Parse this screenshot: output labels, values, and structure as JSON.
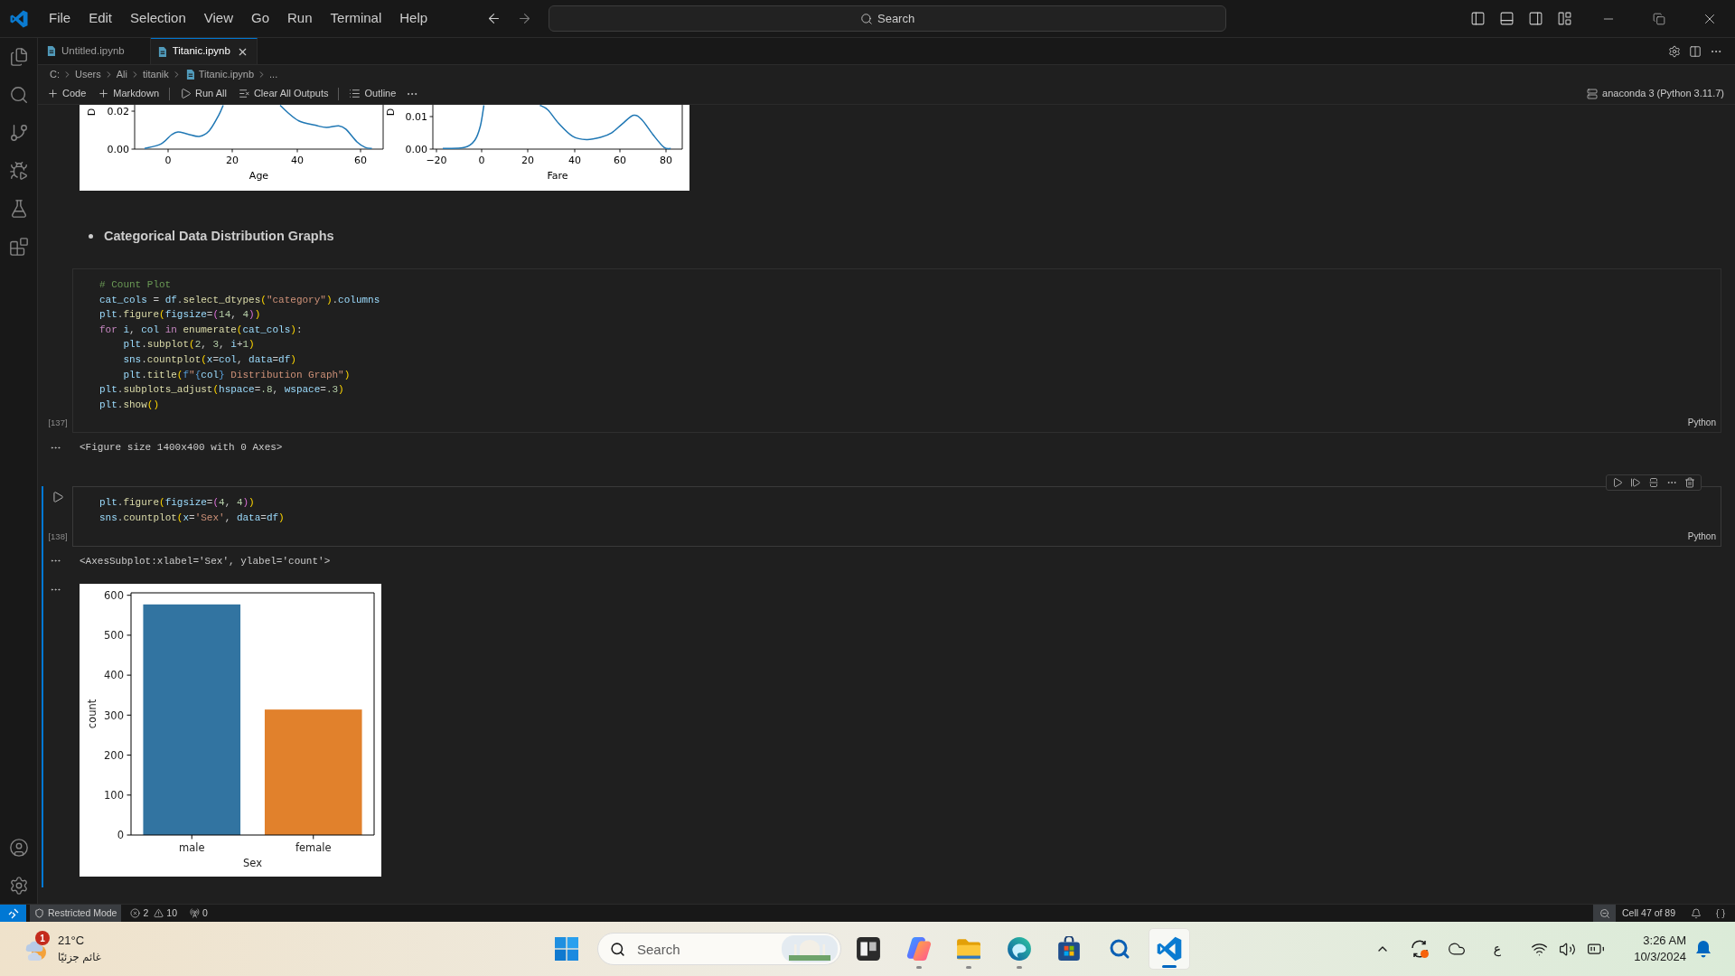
{
  "window": {
    "menu": [
      "File",
      "Edit",
      "Selection",
      "View",
      "Go",
      "Run",
      "Terminal",
      "Help"
    ],
    "search": {
      "label": "Search"
    }
  },
  "tabs": [
    {
      "label": "Untitled.ipynb",
      "selected": false
    },
    {
      "label": "Titanic.ipynb",
      "selected": true
    }
  ],
  "breadcrumb": {
    "folders": [
      "C:",
      "Users",
      "Ali",
      "titanik"
    ],
    "file": "Titanic.ipynb",
    "tail": "..."
  },
  "toolbar": {
    "items": [
      {
        "kind": "add",
        "label": "Code"
      },
      {
        "kind": "add",
        "label": "Markdown"
      },
      {
        "kind": "separator"
      },
      {
        "kind": "run",
        "label": "Run All"
      },
      {
        "kind": "clear",
        "label": "Clear All Outputs"
      },
      {
        "kind": "separator"
      },
      {
        "kind": "outline",
        "label": "Outline"
      },
      {
        "kind": "more"
      }
    ],
    "kernel": "anaconda 3 (Python 3.11.7)"
  },
  "notebook": [
    {
      "kind": "figure",
      "selected": false,
      "panels": [
        {
          "ylabel": "D",
          "yticks": [
            "0.02",
            "0.00"
          ],
          "xticks": [
            "0",
            "20",
            "40",
            "60"
          ],
          "xlabel": "Age"
        },
        {
          "ylabel": "D",
          "yticks": [
            "0.01",
            "0.00"
          ],
          "xticks": [
            "−20",
            "0",
            "20",
            "40",
            "60",
            "80"
          ],
          "xlabel": "Fare"
        }
      ]
    },
    {
      "kind": "markdown",
      "selected": false,
      "bullets": [
        "Categorical Data Distribution Graphs"
      ]
    },
    {
      "kind": "code",
      "selected": false,
      "execution_count": "[137]",
      "language": "Python",
      "lines": [
        [
          {
            "kind": "comment",
            "text": "# Count Plot"
          }
        ],
        [
          {
            "kind": "variable",
            "text": "cat_cols"
          },
          {
            "kind": "operator",
            "text": " = "
          },
          {
            "kind": "variable",
            "text": "df"
          },
          {
            "kind": "operator",
            "text": "."
          },
          {
            "kind": "function",
            "text": "select_dtypes"
          },
          {
            "kind": "bracket1",
            "text": "("
          },
          {
            "kind": "string",
            "text": "\"category\""
          },
          {
            "kind": "bracket1",
            "text": ")"
          },
          {
            "kind": "operator",
            "text": "."
          },
          {
            "kind": "variable",
            "text": "columns"
          }
        ],
        [
          {
            "kind": "variable",
            "text": "plt"
          },
          {
            "kind": "operator",
            "text": "."
          },
          {
            "kind": "function",
            "text": "figure"
          },
          {
            "kind": "bracket1",
            "text": "("
          },
          {
            "kind": "variable",
            "text": "figsize"
          },
          {
            "kind": "operator",
            "text": "="
          },
          {
            "kind": "bracket2",
            "text": "("
          },
          {
            "kind": "number",
            "text": "14"
          },
          {
            "kind": "operator",
            "text": ", "
          },
          {
            "kind": "number",
            "text": "4"
          },
          {
            "kind": "bracket2",
            "text": ")"
          },
          {
            "kind": "bracket1",
            "text": ")"
          }
        ],
        [
          {
            "kind": "keyword",
            "text": "for "
          },
          {
            "kind": "variable",
            "text": "i"
          },
          {
            "kind": "operator",
            "text": ", "
          },
          {
            "kind": "variable",
            "text": "col "
          },
          {
            "kind": "keyword",
            "text": "in "
          },
          {
            "kind": "function",
            "text": "enumerate"
          },
          {
            "kind": "bracket1",
            "text": "("
          },
          {
            "kind": "variable",
            "text": "cat_cols"
          },
          {
            "kind": "bracket1",
            "text": ")"
          },
          {
            "kind": "operator",
            "text": ":"
          }
        ],
        [
          {
            "kind": "variable",
            "text": "    plt"
          },
          {
            "kind": "operator",
            "text": "."
          },
          {
            "kind": "function",
            "text": "subplot"
          },
          {
            "kind": "bracket1",
            "text": "("
          },
          {
            "kind": "number",
            "text": "2"
          },
          {
            "kind": "operator",
            "text": ", "
          },
          {
            "kind": "number",
            "text": "3"
          },
          {
            "kind": "operator",
            "text": ", "
          },
          {
            "kind": "variable",
            "text": "i"
          },
          {
            "kind": "operator",
            "text": "+"
          },
          {
            "kind": "number",
            "text": "1"
          },
          {
            "kind": "bracket1",
            "text": ")"
          }
        ],
        [
          {
            "kind": "variable",
            "text": "    sns"
          },
          {
            "kind": "operator",
            "text": "."
          },
          {
            "kind": "function",
            "text": "countplot"
          },
          {
            "kind": "bracket1",
            "text": "("
          },
          {
            "kind": "variable",
            "text": "x"
          },
          {
            "kind": "operator",
            "text": "="
          },
          {
            "kind": "variable",
            "text": "col"
          },
          {
            "kind": "operator",
            "text": ", "
          },
          {
            "kind": "variable",
            "text": "data"
          },
          {
            "kind": "operator",
            "text": "="
          },
          {
            "kind": "variable",
            "text": "df"
          },
          {
            "kind": "bracket1",
            "text": ")"
          }
        ],
        [
          {
            "kind": "variable",
            "text": "    plt"
          },
          {
            "kind": "operator",
            "text": "."
          },
          {
            "kind": "function",
            "text": "title"
          },
          {
            "kind": "bracket1",
            "text": "("
          },
          {
            "kind": "storage",
            "text": "f"
          },
          {
            "kind": "string",
            "text": "\""
          },
          {
            "kind": "storage",
            "text": "{"
          },
          {
            "kind": "variable",
            "text": "col"
          },
          {
            "kind": "storage",
            "text": "}"
          },
          {
            "kind": "string",
            "text": " Distribution Graph\""
          },
          {
            "kind": "bracket1",
            "text": ")"
          }
        ],
        [
          {
            "kind": "variable",
            "text": "plt"
          },
          {
            "kind": "operator",
            "text": "."
          },
          {
            "kind": "function",
            "text": "subplots_adjust"
          },
          {
            "kind": "bracket1",
            "text": "("
          },
          {
            "kind": "variable",
            "text": "hspace"
          },
          {
            "kind": "operator",
            "text": "="
          },
          {
            "kind": "number",
            "text": ".8"
          },
          {
            "kind": "operator",
            "text": ", "
          },
          {
            "kind": "variable",
            "text": "wspace"
          },
          {
            "kind": "operator",
            "text": "="
          },
          {
            "kind": "number",
            "text": ".3"
          },
          {
            "kind": "bracket1",
            "text": ")"
          }
        ],
        [
          {
            "kind": "variable",
            "text": "plt"
          },
          {
            "kind": "operator",
            "text": "."
          },
          {
            "kind": "function",
            "text": "show"
          },
          {
            "kind": "bracket1",
            "text": "()"
          }
        ]
      ],
      "outputs": [
        {
          "kind": "text",
          "text": "<Figure size 1400x400 with 0 Axes>"
        }
      ]
    },
    {
      "kind": "code",
      "selected": true,
      "execution_count": "[138]",
      "language": "Python",
      "lines": [
        [
          {
            "kind": "variable",
            "text": "plt"
          },
          {
            "kind": "operator",
            "text": "."
          },
          {
            "kind": "function",
            "text": "figure"
          },
          {
            "kind": "bracket1",
            "text": "("
          },
          {
            "kind": "variable",
            "text": "figsize"
          },
          {
            "kind": "operator",
            "text": "="
          },
          {
            "kind": "bracket2",
            "text": "("
          },
          {
            "kind": "number",
            "text": "4"
          },
          {
            "kind": "operator",
            "text": ", "
          },
          {
            "kind": "number",
            "text": "4"
          },
          {
            "kind": "bracket2",
            "text": ")"
          },
          {
            "kind": "bracket1",
            "text": ")"
          }
        ],
        [
          {
            "kind": "variable",
            "text": "sns"
          },
          {
            "kind": "operator",
            "text": "."
          },
          {
            "kind": "function",
            "text": "countplot"
          },
          {
            "kind": "bracket1",
            "text": "("
          },
          {
            "kind": "variable",
            "text": "x"
          },
          {
            "kind": "operator",
            "text": "="
          },
          {
            "kind": "string",
            "text": "'Sex'"
          },
          {
            "kind": "operator",
            "text": ", "
          },
          {
            "kind": "variable",
            "text": "data"
          },
          {
            "kind": "operator",
            "text": "="
          },
          {
            "kind": "variable",
            "text": "df"
          },
          {
            "kind": "bracket1",
            "text": ")"
          }
        ]
      ],
      "outputs": [
        {
          "kind": "text",
          "text": "<AxesSubplot:xlabel='Sex', ylabel='count'>"
        },
        {
          "kind": "chart",
          "chart_data": {
            "type": "bar",
            "categories": [
              "male",
              "female"
            ],
            "values": [
              577,
              314
            ],
            "colors": [
              "#3274a1",
              "#e1812c"
            ],
            "xlabel": "Sex",
            "ylabel": "count",
            "yticks": [
              0,
              100,
              200,
              300,
              400,
              500,
              600
            ],
            "ylim": [
              0,
              606
            ]
          }
        }
      ]
    }
  ],
  "status_bar": {
    "restricted_mode": "Restricted Mode",
    "errors": "2",
    "warnings": "10",
    "ports": "0",
    "cell_position": "Cell 47 of 89"
  },
  "taskbar": {
    "weather": {
      "badge": "1",
      "temperature": "21°C",
      "condition": "غائم جزئيًا"
    },
    "search": {
      "placeholder": "Search"
    },
    "apps": [
      {
        "kind": "dark",
        "running": false,
        "selected": false
      },
      {
        "kind": "swirl",
        "running": true,
        "selected": false
      },
      {
        "kind": "folder",
        "running": true,
        "selected": false
      },
      {
        "kind": "browser",
        "running": true,
        "selected": false
      },
      {
        "kind": "store",
        "running": false,
        "selected": false
      },
      {
        "kind": "magnifier",
        "running": false,
        "selected": false
      },
      {
        "kind": "code",
        "running": true,
        "selected": true
      }
    ],
    "tray": {
      "language": "ع",
      "time": "3:26 AM",
      "date": "10/3/2024"
    }
  }
}
